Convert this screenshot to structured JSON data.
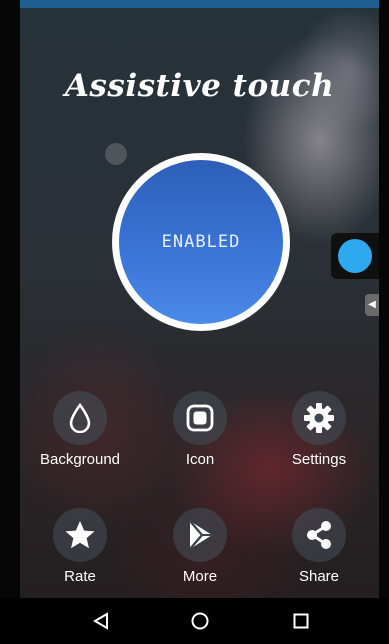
{
  "app": {
    "title": "Assistive touch"
  },
  "toggle": {
    "label": "ENABLED"
  },
  "menu": {
    "items": [
      {
        "id": "background",
        "label": "Background",
        "icon": "drop-icon"
      },
      {
        "id": "icon",
        "label": "Icon",
        "icon": "square-icon"
      },
      {
        "id": "settings",
        "label": "Settings",
        "icon": "gear-icon"
      },
      {
        "id": "rate",
        "label": "Rate",
        "icon": "star-icon"
      },
      {
        "id": "more",
        "label": "More",
        "icon": "play-store-icon"
      },
      {
        "id": "share",
        "label": "Share",
        "icon": "share-icon"
      }
    ]
  },
  "floating_button": {
    "icon": "assistive-dot-icon",
    "color": "#2ea8ee"
  },
  "navigation": {
    "back_icon": "back-icon",
    "home_icon": "home-icon",
    "recents_icon": "recents-icon"
  },
  "colors": {
    "accent": "#3a74d6",
    "status_bar": "#1f5f8f"
  }
}
